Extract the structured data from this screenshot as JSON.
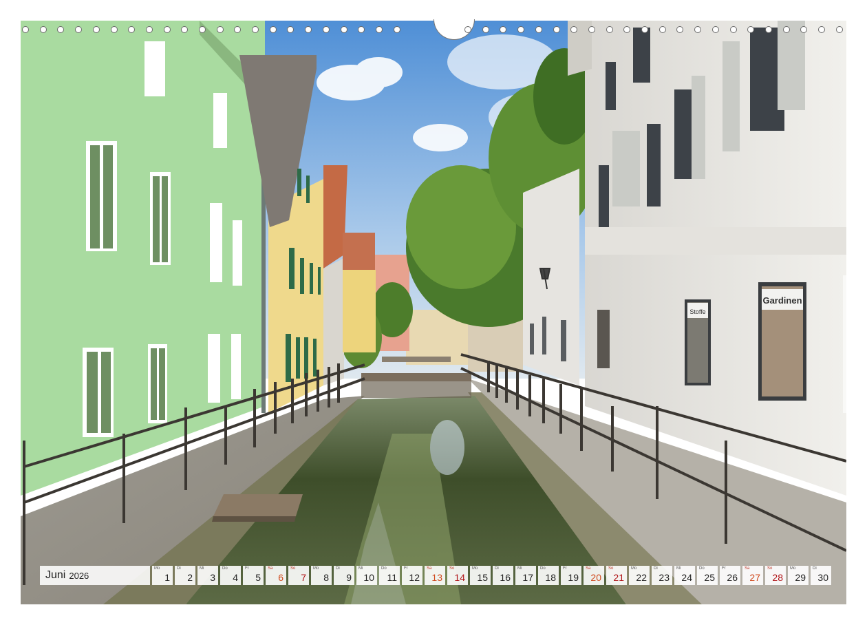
{
  "calendar": {
    "month": "Juni",
    "year": "2026",
    "days": [
      {
        "n": "1",
        "wd": "Mo",
        "type": "wd"
      },
      {
        "n": "2",
        "wd": "Di",
        "type": "wd"
      },
      {
        "n": "3",
        "wd": "Mi",
        "type": "wd"
      },
      {
        "n": "4",
        "wd": "Do",
        "type": "wd"
      },
      {
        "n": "5",
        "wd": "Fr",
        "type": "wd"
      },
      {
        "n": "6",
        "wd": "Sa",
        "type": "sat"
      },
      {
        "n": "7",
        "wd": "So",
        "type": "sun"
      },
      {
        "n": "8",
        "wd": "Mo",
        "type": "wd"
      },
      {
        "n": "9",
        "wd": "Di",
        "type": "wd"
      },
      {
        "n": "10",
        "wd": "Mi",
        "type": "wd"
      },
      {
        "n": "11",
        "wd": "Do",
        "type": "wd"
      },
      {
        "n": "12",
        "wd": "Fr",
        "type": "wd"
      },
      {
        "n": "13",
        "wd": "Sa",
        "type": "sat"
      },
      {
        "n": "14",
        "wd": "So",
        "type": "sun"
      },
      {
        "n": "15",
        "wd": "Mo",
        "type": "wd"
      },
      {
        "n": "16",
        "wd": "Di",
        "type": "wd"
      },
      {
        "n": "17",
        "wd": "Mi",
        "type": "wd"
      },
      {
        "n": "18",
        "wd": "Do",
        "type": "wd"
      },
      {
        "n": "19",
        "wd": "Fr",
        "type": "wd"
      },
      {
        "n": "20",
        "wd": "Sa",
        "type": "sat"
      },
      {
        "n": "21",
        "wd": "So",
        "type": "sun"
      },
      {
        "n": "22",
        "wd": "Mo",
        "type": "wd"
      },
      {
        "n": "23",
        "wd": "Di",
        "type": "wd"
      },
      {
        "n": "24",
        "wd": "Mi",
        "type": "wd"
      },
      {
        "n": "25",
        "wd": "Do",
        "type": "wd"
      },
      {
        "n": "26",
        "wd": "Fr",
        "type": "wd"
      },
      {
        "n": "27",
        "wd": "Sa",
        "type": "sat"
      },
      {
        "n": "28",
        "wd": "So",
        "type": "sun"
      },
      {
        "n": "29",
        "wd": "Mo",
        "type": "wd"
      },
      {
        "n": "30",
        "wd": "Di",
        "type": "wd"
      }
    ]
  },
  "photo": {
    "shop_signs": {
      "left": "Stoffe",
      "right": "Gardinen"
    }
  },
  "colors": {
    "green_house": "#a9dba0",
    "yellow_house": "#efd98c",
    "white_house": "#ecebe8",
    "sky": "#6fa9e0",
    "water": "#4f5a36",
    "saturday": "#d04a1e",
    "sunday": "#b01418"
  }
}
